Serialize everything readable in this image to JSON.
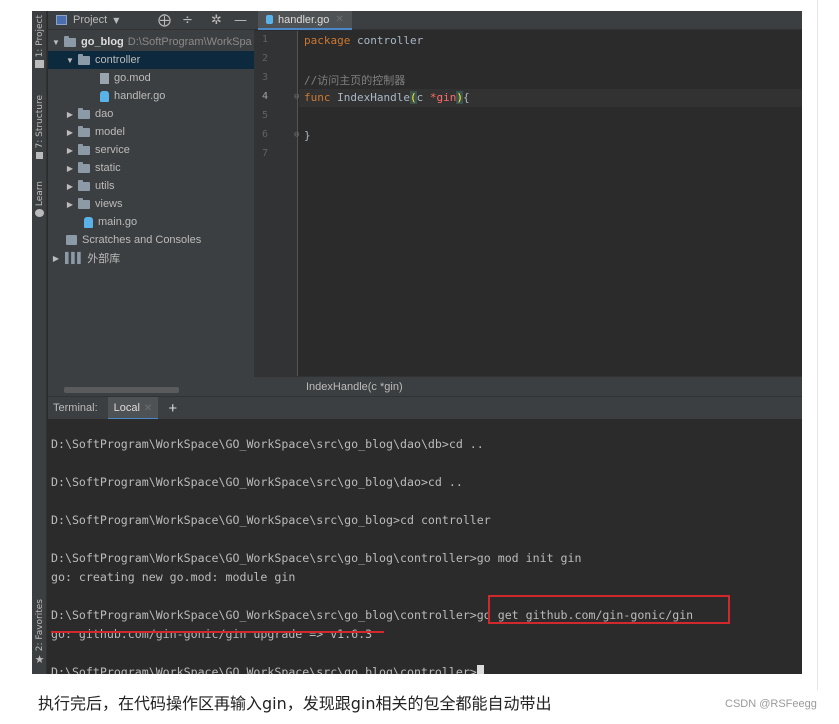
{
  "tool_strip": {
    "project_tab": "1: Project",
    "structure_tab": "7: Structure",
    "learn_tab": "Learn",
    "favorites_tab": "2: Favorites"
  },
  "project_panel": {
    "title": "Project",
    "tree": [
      {
        "label": "go_blog",
        "path": "D:\\SoftProgram\\WorkSpa",
        "type": "folder",
        "expanded": true
      },
      {
        "label": "controller",
        "type": "folder",
        "expanded": true,
        "selected": true
      },
      {
        "label": "go.mod",
        "type": "gomod"
      },
      {
        "label": "handler.go",
        "type": "gofile"
      },
      {
        "label": "dao",
        "type": "folder"
      },
      {
        "label": "model",
        "type": "folder"
      },
      {
        "label": "service",
        "type": "folder"
      },
      {
        "label": "static",
        "type": "folder"
      },
      {
        "label": "utils",
        "type": "folder"
      },
      {
        "label": "views",
        "type": "folder"
      },
      {
        "label": "main.go",
        "type": "gofile"
      },
      {
        "label": "Scratches and Consoles",
        "type": "scratch"
      },
      {
        "label": "外部库",
        "type": "library"
      }
    ]
  },
  "editor": {
    "tab_label": "handler.go",
    "line_numbers": [
      "1",
      "2",
      "3",
      "4",
      "5",
      "6",
      "7"
    ],
    "code": {
      "l1_kw": "package",
      "l1_name": " controller",
      "l3_comment": "//访问主页的控制器",
      "l4_kw": "func",
      "l4_name": " IndexHandle",
      "l4_open": "(",
      "l4_param": "c ",
      "l4_star": "*",
      "l4_type": "gin",
      "l4_close": ")",
      "l4_brace": "{",
      "l6_brace": "}"
    },
    "breadcrumb": "IndexHandle(c *gin)"
  },
  "terminal": {
    "label": "Terminal:",
    "tab": "Local",
    "add": "+",
    "lines": [
      "D:\\SoftProgram\\WorkSpace\\GO_WorkSpace\\src\\go_blog\\dao\\db>cd ..",
      "",
      "D:\\SoftProgram\\WorkSpace\\GO_WorkSpace\\src\\go_blog\\dao>cd ..",
      "",
      "D:\\SoftProgram\\WorkSpace\\GO_WorkSpace\\src\\go_blog>cd controller",
      "",
      "D:\\SoftProgram\\WorkSpace\\GO_WorkSpace\\src\\go_blog\\controller>go mod init gin",
      "go: creating new go.mod: module gin",
      "",
      "D:\\SoftProgram\\WorkSpace\\GO_WorkSpace\\src\\go_blog\\controller>go get github.com/gin-gonic/gin",
      "go: github.com/gin-gonic/gin upgrade => v1.6.3",
      "",
      "D:\\SoftProgram\\WorkSpace\\GO_WorkSpace\\src\\go_blog\\controller>"
    ]
  },
  "caption": "执行完后，在代码操作区再输入gin，发现跟gin相关的包全都能自动带出",
  "watermark": "CSDN @RSFeegg",
  "colors": {
    "keyword": "#cc7832",
    "comment": "#808080",
    "type": "#ff6b68",
    "annotation_red": "#d0282c",
    "selection": "#0d293e"
  }
}
